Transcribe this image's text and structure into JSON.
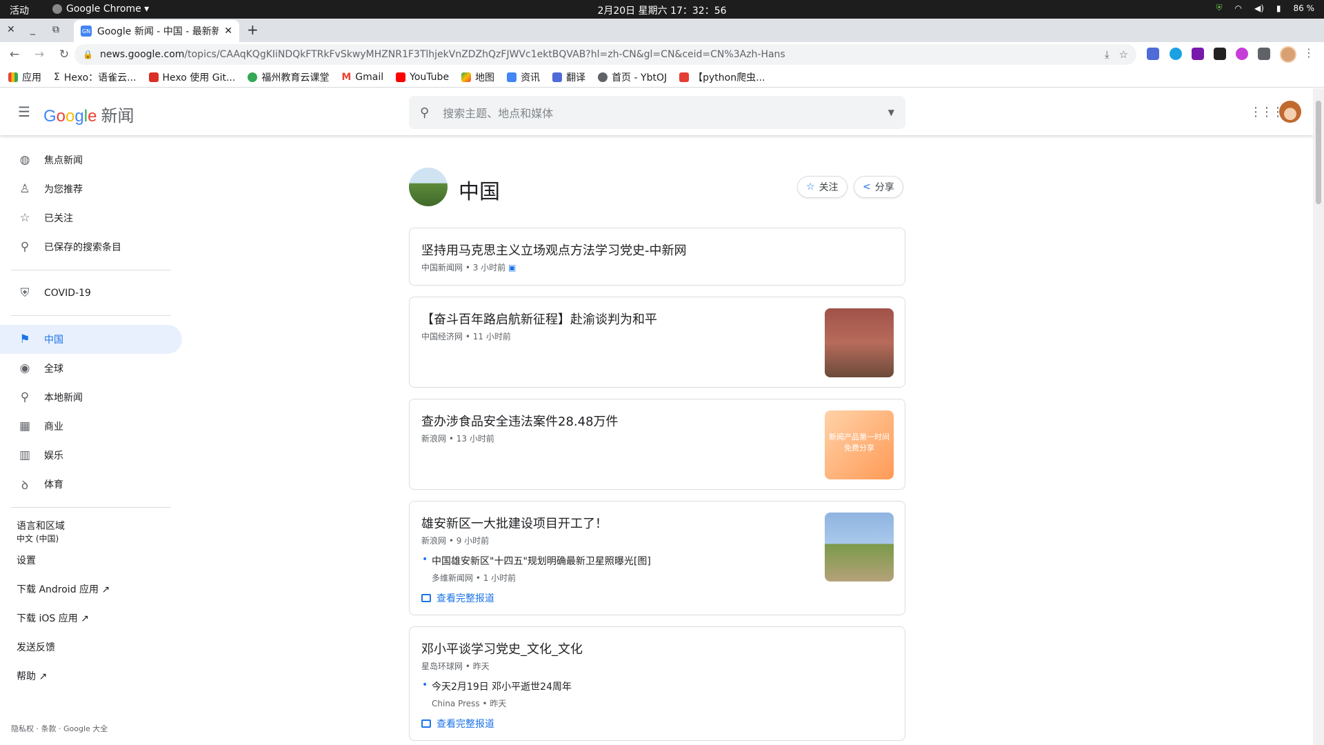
{
  "system_bar": {
    "activities": "活动",
    "app_name": "Google Chrome ▾",
    "clock": "2月20日 星期六 17：32：56",
    "battery": "86 %"
  },
  "browser": {
    "tab_title": "Google 新闻 - 中国 - 最新新",
    "tab_favicon": "GN",
    "url_host": "news.google.com",
    "url_path": "/topics/CAAqKQgKIiNDQkFTRkFvSkwyMHZNR1F3TlhjekVnZDZhQzFJWVc1ektBQVAB?hl=zh-CN&gl=CN&ceid=CN%3Azh-Hans",
    "bookmarks": [
      {
        "label": "应用",
        "icon": "apps-grid-icon",
        "color": "#ea4335"
      },
      {
        "label": "Hexo：语雀云...",
        "icon": "sigma-icon",
        "color": "#444444"
      },
      {
        "label": "Hexo 使用 Git...",
        "icon": "hexo-icon",
        "color": "#d93025"
      },
      {
        "label": "福州教育云课堂",
        "icon": "wechat-icon",
        "color": "#34a853"
      },
      {
        "label": "Gmail",
        "icon": "gmail-icon",
        "color": "#ea4335"
      },
      {
        "label": "YouTube",
        "icon": "youtube-icon",
        "color": "#ff0000"
      },
      {
        "label": "地图",
        "icon": "maps-icon",
        "color": "#34a853"
      },
      {
        "label": "资讯",
        "icon": "news-icon",
        "color": "#4285f4"
      },
      {
        "label": "翻译",
        "icon": "translate-icon",
        "color": "#4285f4"
      },
      {
        "label": "首页 - YbtOJ",
        "icon": "globe-icon",
        "color": "#5f6368"
      },
      {
        "label": "【python爬虫...",
        "icon": "csdn-icon",
        "color": "#e33e33"
      }
    ]
  },
  "header": {
    "logo_google": [
      "G",
      "o",
      "o",
      "g",
      "l",
      "e"
    ],
    "logo_news": "新闻",
    "search_placeholder": "搜索主题、地点和媒体"
  },
  "sidebar": {
    "items": [
      {
        "label": "焦点新闻",
        "icon": "globe-icon"
      },
      {
        "label": "为您推荐",
        "icon": "person-icon"
      },
      {
        "label": "已关注",
        "icon": "star-icon"
      },
      {
        "label": "已保存的搜索条目",
        "icon": "search-icon"
      },
      {
        "label": "COVID-19",
        "icon": "shield-icon"
      },
      {
        "label": "中国",
        "icon": "flag-icon"
      },
      {
        "label": "全球",
        "icon": "world-icon"
      },
      {
        "label": "本地新闻",
        "icon": "location-pin-icon"
      },
      {
        "label": "商业",
        "icon": "building-icon"
      },
      {
        "label": "娱乐",
        "icon": "film-icon"
      },
      {
        "label": "体育",
        "icon": "bicycle-icon"
      }
    ],
    "language_label": "语言和区域",
    "language_value": "中文 (中国)",
    "settings": "设置",
    "android": "下载 Android 应用",
    "ios": "下载 iOS 应用",
    "feedback": "发送反馈",
    "help": "帮助",
    "footer": "隐私权 · 条款 · Google 大全"
  },
  "topic": {
    "name": "中国",
    "follow": "关注",
    "share": "分享"
  },
  "articles": [
    {
      "title": "坚持用马克思主义立场观点方法学习党史-中新网",
      "source": "中国新闻网",
      "time": "3 小时前"
    },
    {
      "title": "【奋斗百年路启航新征程】赴渝谈判为和平",
      "source": "中国经济网",
      "time": "11 小时前"
    },
    {
      "title": "查办涉食品安全违法案件28.48万件",
      "source": "新浪网",
      "time": "13 小时前",
      "thumb_text": "新闻产品第一时间免费分享"
    },
    {
      "title": "雄安新区一大批建设项目开工了！",
      "source": "新浪网",
      "time": "9 小时前",
      "sub_title": "中国雄安新区\"十四五\"规划明确最新卫星照曝光[图]",
      "sub_source": "多维新闻网",
      "sub_time": "1 小时前",
      "full": "查看完整报道"
    },
    {
      "title": "邓小平谈学习党史_文化_文化",
      "source": "星岛环球网",
      "time": "昨天",
      "sub_title": "今天2月19日 邓小平逝世24周年",
      "sub_source": "China Press",
      "sub_time": "昨天",
      "full": "查看完整报道"
    }
  ]
}
